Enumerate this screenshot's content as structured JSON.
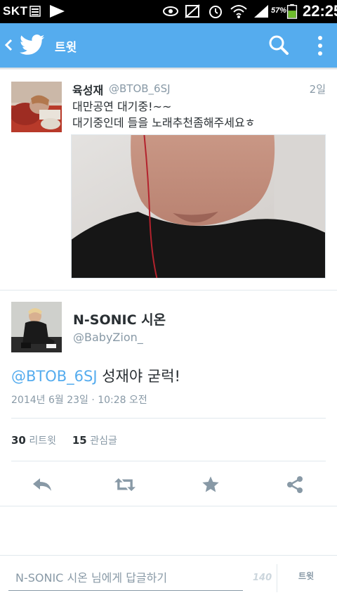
{
  "status_bar": {
    "carrier": "SKT",
    "battery_percent": "57%",
    "clock": "22:25"
  },
  "app_bar": {
    "title": "트윗",
    "brand_color": "#55acee",
    "icons": [
      "back-arrow-icon",
      "twitter-bird-icon",
      "search-icon",
      "overflow-menu-icon"
    ]
  },
  "parent_tweet": {
    "name": "육성재",
    "handle": "@BTOB_6SJ",
    "time": "2일",
    "lines": [
      "대만공연 대기중!~~",
      "대기중인데 들을 노래추천좀해주세요ㅎ"
    ]
  },
  "main_tweet": {
    "name": "N-SONIC 시온",
    "handle": "@BabyZion_",
    "mention": "@BTOB_6SJ",
    "text": " 성재야 굳럭!",
    "date": "2014년 6월 23일 · 10:28 오전",
    "retweet_count": "30",
    "retweet_label": "리트윗",
    "favorite_count": "15",
    "favorite_label": "관심글"
  },
  "actions": [
    "reply-icon",
    "retweet-icon",
    "favorite-star-icon",
    "share-icon"
  ],
  "reply_bar": {
    "placeholder": "N-SONIC 시온 님에게 답글하기",
    "char_count": "140",
    "tweet_button": "트윗"
  }
}
